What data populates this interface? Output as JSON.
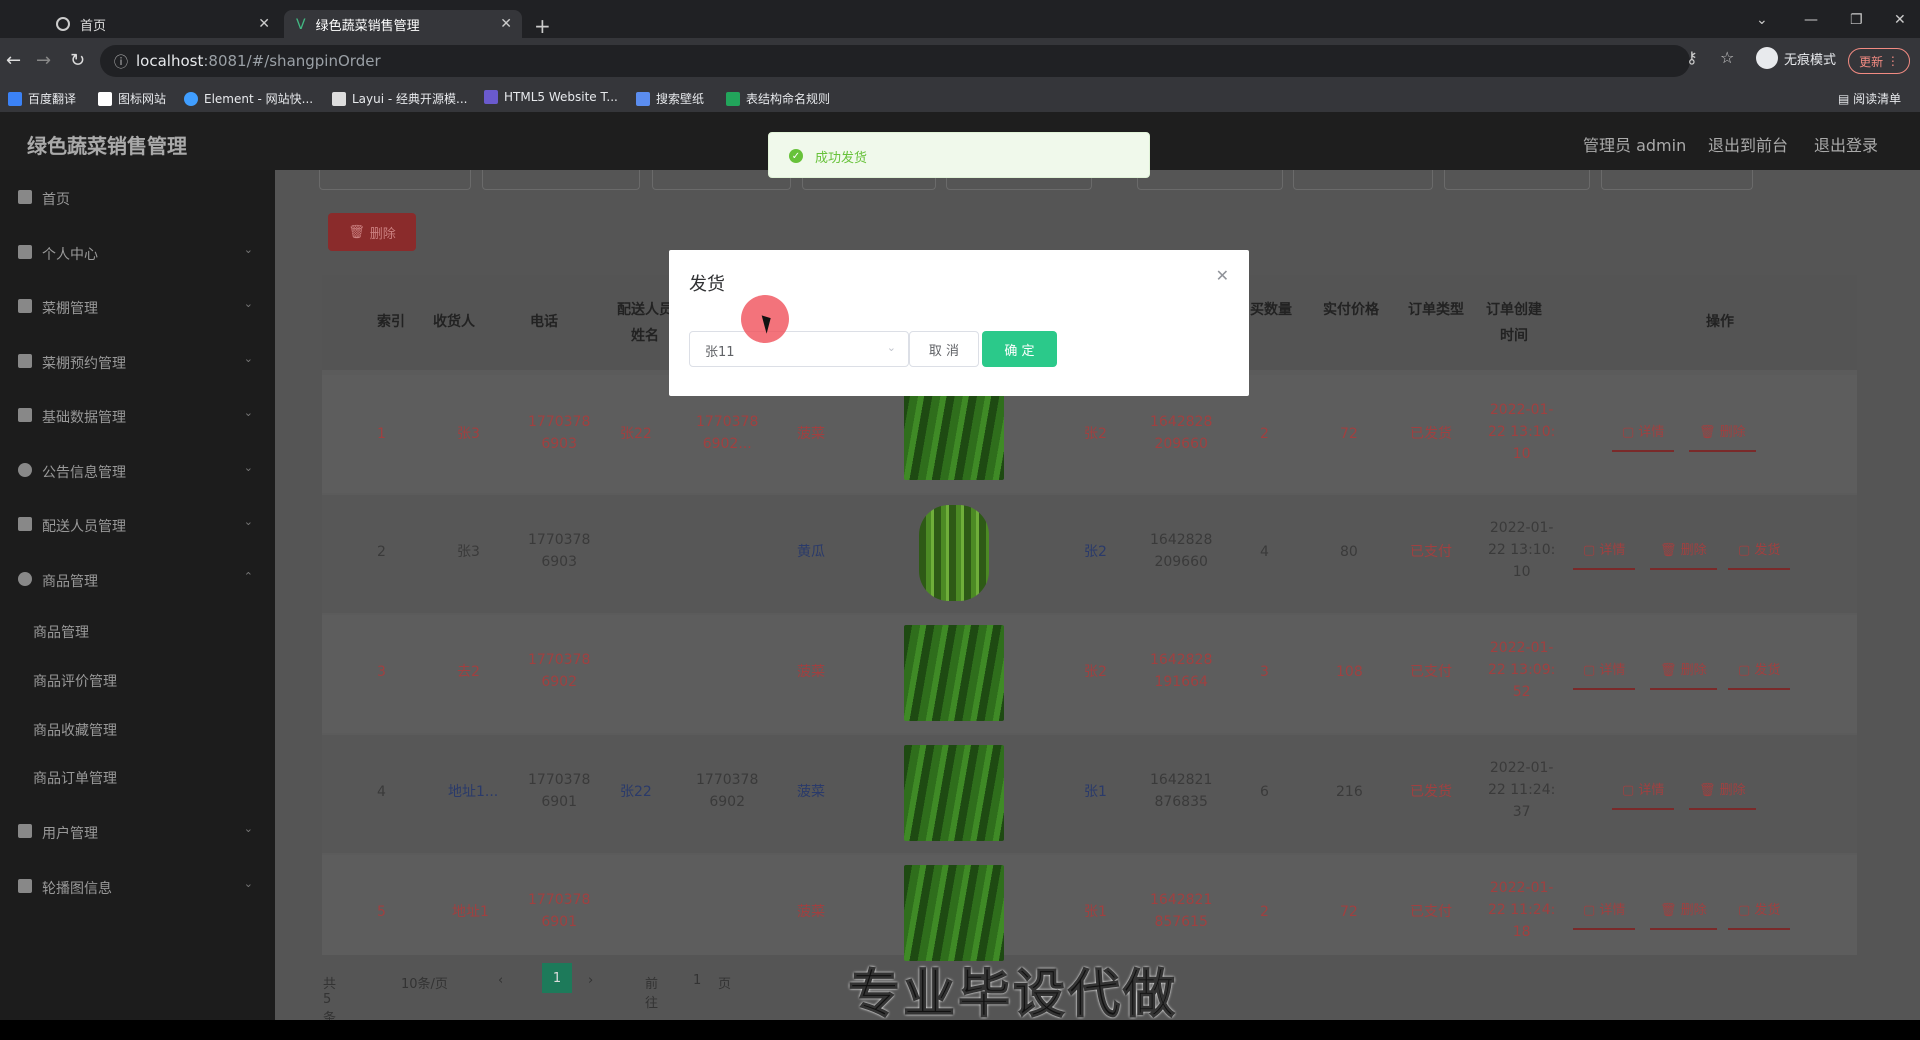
{
  "browser": {
    "tabs": [
      {
        "label": "首页",
        "active": false
      },
      {
        "label": "绿色蔬菜销售管理",
        "active": true
      }
    ],
    "url_host": "localhost",
    "url_path": ":8081/#/shangpinOrder",
    "incognito_label": "无痕模式",
    "update_label": "更新",
    "bookmarks": [
      "百度翻译",
      "图标网站",
      "Element - 网站快...",
      "Layui - 经典开源模...",
      "HTML5 Website T...",
      "搜索壁纸",
      "表结构命名规则"
    ],
    "reading_list": "阅读清单"
  },
  "app": {
    "title": "绿色蔬菜销售管理",
    "header_links": [
      "管理员 admin",
      "退出到前台",
      "退出登录"
    ]
  },
  "sidebar": {
    "items": [
      {
        "label": "首页",
        "icon": "home-icon"
      },
      {
        "label": "个人中心",
        "icon": "user-icon"
      },
      {
        "label": "菜棚管理",
        "icon": "list-icon"
      },
      {
        "label": "菜棚预约管理",
        "icon": "send-icon"
      },
      {
        "label": "基础数据管理",
        "icon": "clipboard-icon"
      },
      {
        "label": "公告信息管理",
        "icon": "globe-icon"
      },
      {
        "label": "配送人员管理",
        "icon": "bar-chart-icon"
      },
      {
        "label": "商品管理",
        "icon": "location-icon"
      }
    ],
    "sub_items": [
      "商品管理",
      "商品评价管理",
      "商品收藏管理",
      "商品订单管理"
    ],
    "bottom_items": [
      {
        "label": "用户管理",
        "icon": "chart-icon"
      },
      {
        "label": "轮播图信息",
        "icon": "sliders-icon"
      }
    ]
  },
  "toolbar": {
    "delete_label": "删除"
  },
  "table": {
    "headers": [
      "索引",
      "收货人",
      "电话",
      "配送人员\n姓名",
      "买数量",
      "实付价格",
      "订单类型",
      "订单创建\n时间",
      "操作"
    ],
    "rows": [
      {
        "index": "1",
        "receiver": "张3",
        "phone": "1770378\n6903",
        "courier": "张22",
        "courier_phone": "1770378\n6902...",
        "product": "菠菜",
        "buyer": "张2",
        "order_no": "1642828\n209660",
        "qty": "2",
        "price": "72",
        "status": "已发货",
        "created": "2022-01-\n22 13:10:\n10",
        "ops": [
          "详情",
          "删除"
        ]
      },
      {
        "index": "2",
        "receiver": "张3",
        "phone": "1770378\n6903",
        "courier": "",
        "courier_phone": "",
        "product": "黄瓜",
        "buyer": "张2",
        "order_no": "1642828\n209660",
        "qty": "4",
        "price": "80",
        "status": "已支付",
        "created": "2022-01-\n22 13:10:\n10",
        "ops": [
          "详情",
          "删除",
          "发货"
        ]
      },
      {
        "index": "3",
        "receiver": "去2",
        "phone": "1770378\n6902",
        "courier": "",
        "courier_phone": "",
        "product": "菠菜",
        "buyer": "张2",
        "order_no": "1642828\n191664",
        "qty": "3",
        "price": "108",
        "status": "已支付",
        "created": "2022-01-\n22 13:09:\n52",
        "ops": [
          "详情",
          "删除",
          "发货"
        ]
      },
      {
        "index": "4",
        "receiver": "地址1...",
        "phone": "1770378\n6901",
        "courier": "张22",
        "courier_phone": "1770378\n6902",
        "product": "菠菜",
        "buyer": "张1",
        "order_no": "1642821\n876835",
        "qty": "6",
        "price": "216",
        "status": "已发货",
        "created": "2022-01-\n22 11:24:\n37",
        "ops": [
          "详情",
          "删除"
        ]
      },
      {
        "index": "5",
        "receiver": "地址1",
        "phone": "1770378\n6901",
        "courier": "",
        "courier_phone": "",
        "product": "菠菜",
        "buyer": "张1",
        "order_no": "1642821\n857615",
        "qty": "2",
        "price": "72",
        "status": "已支付",
        "created": "2022-01-\n22 11:24:\n18",
        "ops": [
          "详情",
          "删除",
          "发货"
        ]
      }
    ]
  },
  "pagination": {
    "total": "共 5 条",
    "page_size": "10条/页",
    "current": "1",
    "goto_label": "前往",
    "goto_value": "1",
    "page_unit": "页"
  },
  "toast": {
    "message": "成功发货"
  },
  "dialog": {
    "title": "发货",
    "selected": "张11",
    "cancel_label": "取 消",
    "confirm_label": "确 定"
  },
  "overlay_caption": "专业毕设代做"
}
